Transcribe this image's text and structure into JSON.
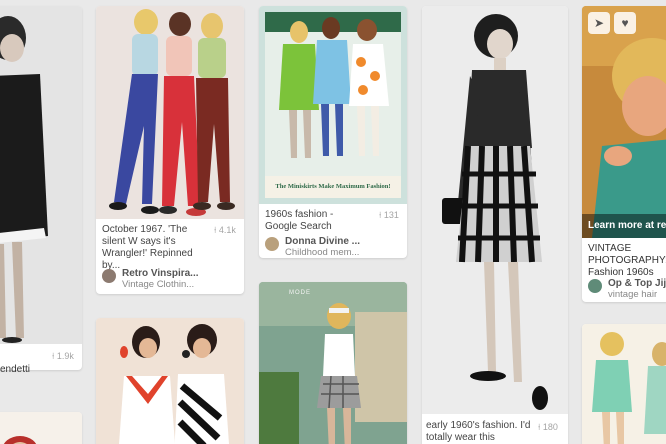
{
  "pins": {
    "col1": {
      "name_fragment": "endetti",
      "saves": "1.9k"
    },
    "col2a": {
      "description": "October 1967. 'The silent W says it's Wrangler!' Repinned by...",
      "saves": "4.1k",
      "pinner_name": "Retro Vinspira...",
      "pinner_board": "Vintage Clothin..."
    },
    "col3a": {
      "caption": "The Miniskirts Make Maximum Fashion!",
      "description": "1960s fashion - Google Search",
      "saves": "131",
      "pinner_name": "Donna Divine ...",
      "pinner_board": "Childhood mem..."
    },
    "col3b": {
      "sign_text": "MODE"
    },
    "col4": {
      "description": "early 1960's fashion. I'd totally wear this",
      "saves": "180"
    },
    "col5": {
      "cta": "Learn more at ret",
      "description": "VINTAGE PHOTOGRAPHY: Fashion 1960s",
      "pinner_name": "Op & Top Jij",
      "pinner_board": "vintage hair"
    }
  },
  "icons": {
    "send": "send-icon",
    "heart": "heart-icon",
    "pin_save": "pin-icon"
  }
}
